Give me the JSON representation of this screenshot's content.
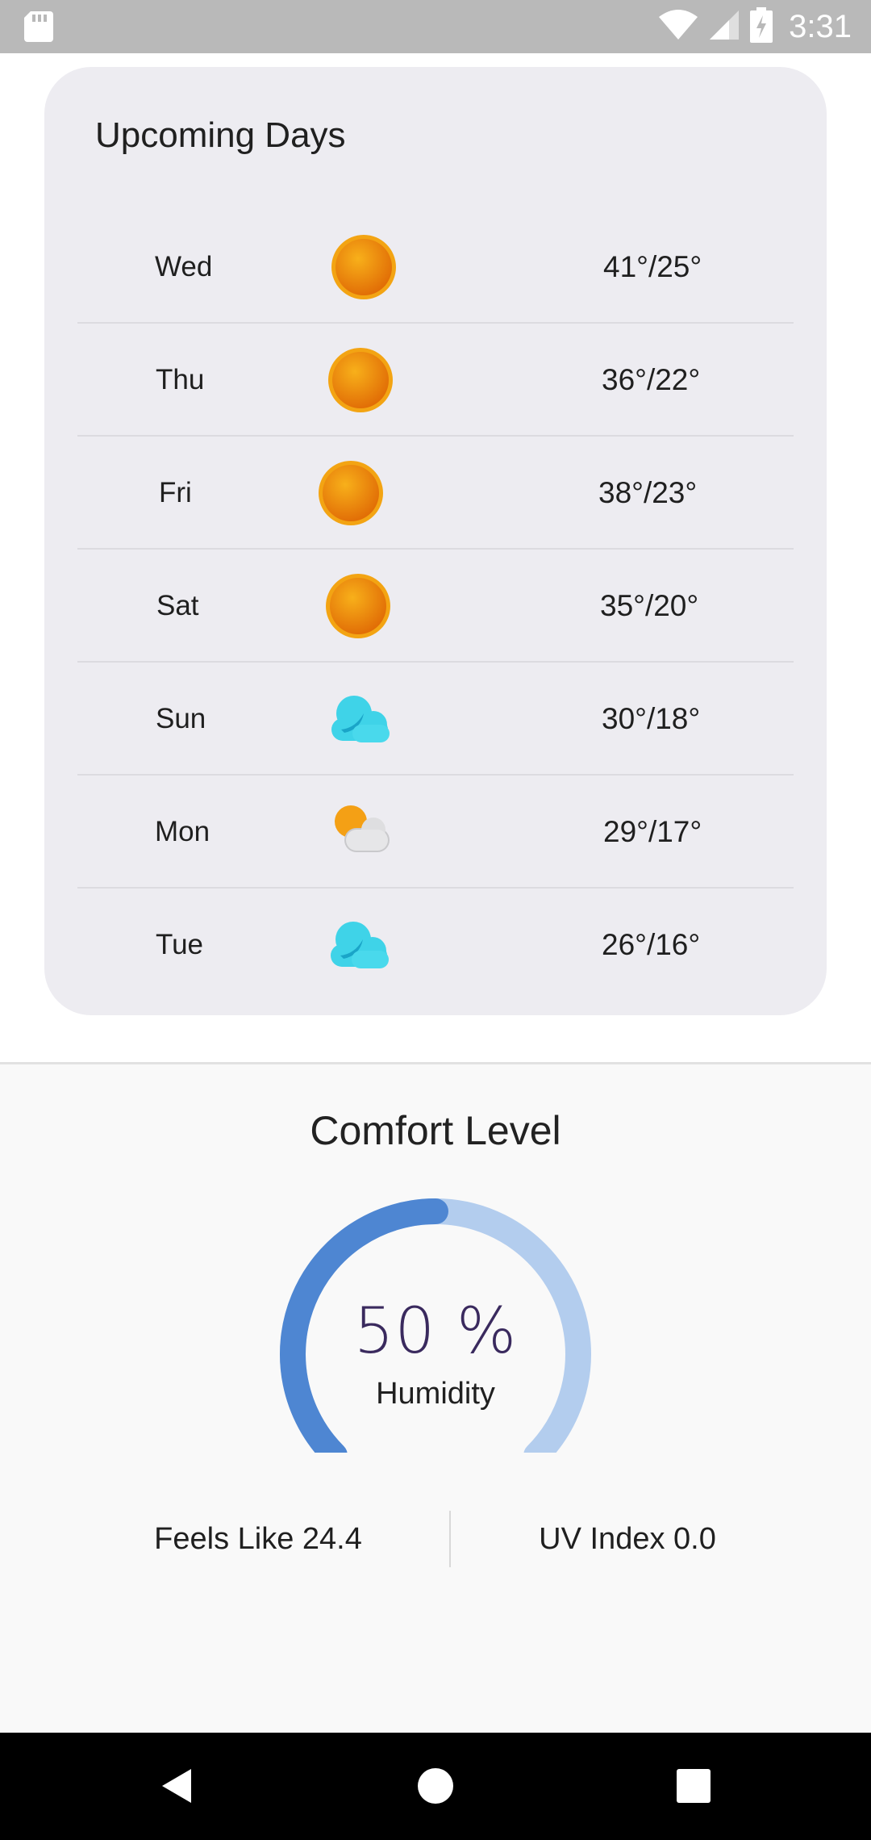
{
  "status_bar": {
    "time": "3:31",
    "icons": [
      "sd-card-icon",
      "wifi-icon",
      "signal-icon",
      "battery-charging-icon"
    ]
  },
  "upcoming": {
    "title": "Upcoming Days",
    "days": [
      {
        "day": "Wed",
        "icon": "sun-icon",
        "temp": "41°/25°"
      },
      {
        "day": "Thu",
        "icon": "sun-icon",
        "temp": "36°/22°"
      },
      {
        "day": "Fri",
        "icon": "sun-icon",
        "temp": "38°/23°"
      },
      {
        "day": "Sat",
        "icon": "sun-icon",
        "temp": "35°/20°"
      },
      {
        "day": "Sun",
        "icon": "cloudy-icon",
        "temp": "30°/18°"
      },
      {
        "day": "Mon",
        "icon": "partly-cloudy-icon",
        "temp": "29°/17°"
      },
      {
        "day": "Tue",
        "icon": "cloudy-icon",
        "temp": "26°/16°"
      }
    ]
  },
  "comfort": {
    "title": "Comfort Level",
    "humidity_value": "50 %",
    "humidity_fraction": 0.5,
    "humidity_label": "Humidity",
    "feels_like": "Feels Like 24.4",
    "uv_index": "UV Index 0.0"
  },
  "colors": {
    "gauge_fill": "#4e86d2",
    "gauge_track": "#b3cdee",
    "card_bg": "#edecf1",
    "sun": "#f29a0b",
    "cloud": "#40d0e6"
  },
  "nav_bar": {
    "buttons": [
      "back-icon",
      "home-icon",
      "recents-icon"
    ]
  }
}
